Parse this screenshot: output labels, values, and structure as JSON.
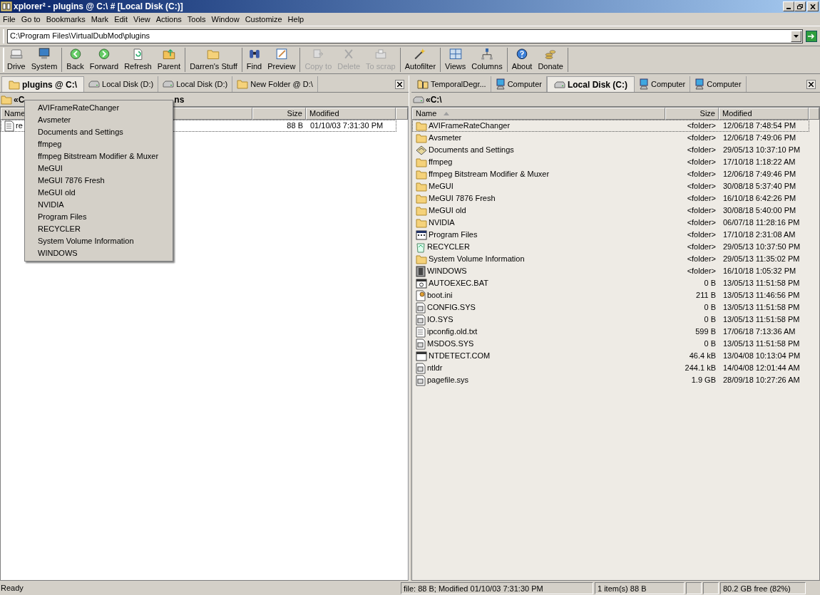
{
  "window": {
    "title": "xplorer² - plugins @ C:\\ # [Local Disk (C:)]"
  },
  "menu": [
    "File",
    "Go to",
    "Bookmarks",
    "Mark",
    "Edit",
    "View",
    "Actions",
    "Tools",
    "Window",
    "Customize",
    "Help"
  ],
  "address": {
    "value": "C:\\Program Files\\VirtualDubMod\\plugins"
  },
  "toolbar": [
    [
      {
        "label": "Drive",
        "kind": "drive",
        "disabled": false
      },
      {
        "label": "System",
        "kind": "system",
        "disabled": false
      }
    ],
    [
      {
        "label": "Back",
        "kind": "back",
        "disabled": false
      },
      {
        "label": "Forward",
        "kind": "forward",
        "disabled": false
      },
      {
        "label": "Refresh",
        "kind": "refresh",
        "disabled": false
      },
      {
        "label": "Parent",
        "kind": "parent",
        "disabled": false
      }
    ],
    [
      {
        "label": "Darren's Stuff",
        "kind": "folder",
        "disabled": false
      }
    ],
    [
      {
        "label": "Find",
        "kind": "find",
        "disabled": false
      },
      {
        "label": "Preview",
        "kind": "preview",
        "disabled": false
      }
    ],
    [
      {
        "label": "Copy to",
        "kind": "copy",
        "disabled": true
      },
      {
        "label": "Delete",
        "kind": "delete",
        "disabled": true
      },
      {
        "label": "To scrap",
        "kind": "scrap",
        "disabled": true
      }
    ],
    [
      {
        "label": "Autofilter",
        "kind": "filter",
        "disabled": false
      }
    ],
    [
      {
        "label": "Views",
        "kind": "views",
        "disabled": false
      },
      {
        "label": "Columns",
        "kind": "columns",
        "disabled": false
      }
    ],
    [
      {
        "label": "About",
        "kind": "about",
        "disabled": false
      },
      {
        "label": "Donate",
        "kind": "donate",
        "disabled": false
      }
    ]
  ],
  "left_pane": {
    "tabs": [
      {
        "label": "plugins @ C:\\",
        "kind": "folder",
        "selected": true
      },
      {
        "label": "Local Disk (D:)",
        "kind": "drive",
        "selected": false
      },
      {
        "label": "Local Disk (D:)",
        "kind": "drive",
        "selected": false
      },
      {
        "label": "New Folder @ D:\\",
        "kind": "folder",
        "selected": false
      }
    ],
    "breadcrumb_head": "«C",
    "breadcrumb_tail": "ns",
    "columns": [
      "Name",
      "Size",
      "Modified"
    ],
    "rows": [
      {
        "name": "re",
        "kind": "text",
        "size": "88 B",
        "modified": "01/10/03 7:31:30 PM",
        "focused": true
      }
    ],
    "popup_menu": [
      "AVIFrameRateChanger",
      "Avsmeter",
      "Documents and Settings",
      "ffmpeg",
      "ffmpeg Bitstream Modifier & Muxer",
      "MeGUI",
      "MeGUI 7876 Fresh",
      "MeGUI old",
      "NVIDIA",
      "Program Files",
      "RECYCLER",
      "System Volume Information",
      "WINDOWS"
    ]
  },
  "right_pane": {
    "tabs": [
      {
        "label": "TemporalDegr...",
        "kind": "zip",
        "selected": false
      },
      {
        "label": "Computer",
        "kind": "computer",
        "selected": false
      },
      {
        "label": "Local Disk (C:)",
        "kind": "drive",
        "selected": true
      },
      {
        "label": "Computer",
        "kind": "computer",
        "selected": false
      },
      {
        "label": "Computer",
        "kind": "computer",
        "selected": false
      }
    ],
    "breadcrumb": "«C:\\",
    "columns": [
      "Name",
      "Size",
      "Modified"
    ],
    "rows": [
      {
        "name": "AVIFrameRateChanger",
        "kind": "folder",
        "size": "<folder>",
        "modified": "12/06/18 7:48:54 PM",
        "focused": true
      },
      {
        "name": "Avsmeter",
        "kind": "folder",
        "size": "<folder>",
        "modified": "12/06/18 7:49:06 PM",
        "focused": false
      },
      {
        "name": "Documents and Settings",
        "kind": "settings",
        "size": "<folder>",
        "modified": "29/05/13 10:37:10 PM",
        "focused": false
      },
      {
        "name": "ffmpeg",
        "kind": "folder",
        "size": "<folder>",
        "modified": "17/10/18 1:18:22 AM",
        "focused": false
      },
      {
        "name": "ffmpeg Bitstream Modifier & Muxer",
        "kind": "folder",
        "size": "<folder>",
        "modified": "12/06/18 7:49:46 PM",
        "focused": false
      },
      {
        "name": "MeGUI",
        "kind": "folder",
        "size": "<folder>",
        "modified": "30/08/18 5:37:40 PM",
        "focused": false
      },
      {
        "name": "MeGUI 7876 Fresh",
        "kind": "folder",
        "size": "<folder>",
        "modified": "16/10/18 6:42:26 PM",
        "focused": false
      },
      {
        "name": "MeGUI old",
        "kind": "folder",
        "size": "<folder>",
        "modified": "30/08/18 5:40:00 PM",
        "focused": false
      },
      {
        "name": "NVIDIA",
        "kind": "folder",
        "size": "<folder>",
        "modified": "06/07/18 11:28:16 PM",
        "focused": false
      },
      {
        "name": "Program Files",
        "kind": "program",
        "size": "<folder>",
        "modified": "17/10/18 2:31:08 AM",
        "focused": false
      },
      {
        "name": "RECYCLER",
        "kind": "recycle",
        "size": "<folder>",
        "modified": "29/05/13 10:37:50 PM",
        "focused": false
      },
      {
        "name": "System Volume Information",
        "kind": "folder",
        "size": "<folder>",
        "modified": "29/05/13 11:35:02 PM",
        "focused": false
      },
      {
        "name": "WINDOWS",
        "kind": "windows",
        "size": "<folder>",
        "modified": "16/10/18 1:05:32 PM",
        "focused": false
      },
      {
        "name": "AUTOEXEC.BAT",
        "kind": "batch",
        "size": "0 B",
        "modified": "13/05/13 11:51:58 PM",
        "focused": false
      },
      {
        "name": "boot.ini",
        "kind": "config",
        "size": "211 B",
        "modified": "13/05/13 11:46:56 PM",
        "focused": false
      },
      {
        "name": "CONFIG.SYS",
        "kind": "system",
        "size": "0 B",
        "modified": "13/05/13 11:51:58 PM",
        "focused": false
      },
      {
        "name": "IO.SYS",
        "kind": "system",
        "size": "0 B",
        "modified": "13/05/13 11:51:58 PM",
        "focused": false
      },
      {
        "name": "ipconfig.old.txt",
        "kind": "text",
        "size": "599 B",
        "modified": "17/06/18 7:13:36 AM",
        "focused": false
      },
      {
        "name": "MSDOS.SYS",
        "kind": "system",
        "size": "0 B",
        "modified": "13/05/13 11:51:58 PM",
        "focused": false
      },
      {
        "name": "NTDETECT.COM",
        "kind": "app",
        "size": "46.4 kB",
        "modified": "13/04/08 10:13:04 PM",
        "focused": false
      },
      {
        "name": "ntldr",
        "kind": "system",
        "size": "244.1 kB",
        "modified": "14/04/08 12:01:44 AM",
        "focused": false
      },
      {
        "name": "pagefile.sys",
        "kind": "system",
        "size": "1.9 GB",
        "modified": "28/09/18 10:27:26 AM",
        "focused": false
      }
    ]
  },
  "status_bar": {
    "message": "Ready",
    "file_info": "file: 88 B; Modified 01/10/03 7:31:30 PM",
    "selection": "1 item(s) 88 B",
    "free_space": "80.2 GB free (82%)"
  }
}
